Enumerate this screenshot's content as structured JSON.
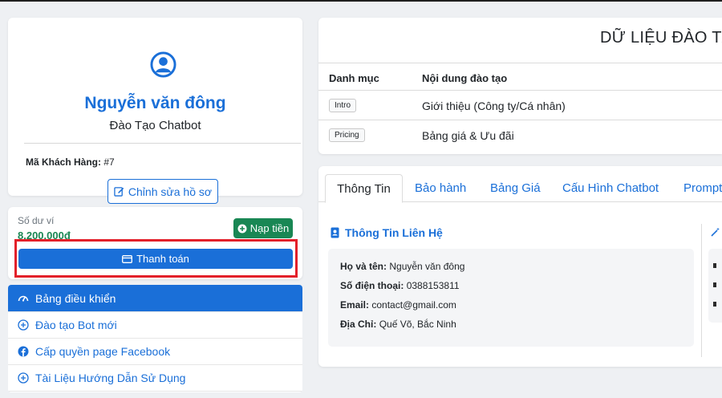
{
  "profile": {
    "name": "Nguyễn văn đông",
    "role": "Đào Tạo Chatbot",
    "customer_id_label": "Mã Khách Hàng:",
    "customer_id_value": "#7",
    "edit_button": "Chỉnh sửa hồ sơ"
  },
  "wallet": {
    "label": "Số dư ví",
    "amount": "8.200.000đ",
    "topup_button": "Nạp tiền",
    "pay_button": "Thanh toán"
  },
  "menu": {
    "items": [
      {
        "label": "Bảng điều khiển",
        "icon": "dashboard-icon"
      },
      {
        "label": "Đào tạo Bot mới",
        "icon": "plus-circle-icon"
      },
      {
        "label": "Cấp quyền page Facebook",
        "icon": "facebook-icon"
      },
      {
        "label": "Tài Liệu Hướng Dẫn Sử Dụng",
        "icon": "plus-circle-icon"
      }
    ]
  },
  "training_data": {
    "title": "DỮ LIỆU ĐÀO TẠ",
    "headers": [
      "Danh mục",
      "Nội dung đào tạo"
    ],
    "rows": [
      {
        "tag": "Intro",
        "content": "Giới thiệu (Công ty/Cá nhân)"
      },
      {
        "tag": "Pricing",
        "content": "Bảng giá & Ưu đãi"
      }
    ]
  },
  "tabs": {
    "items": [
      "Thông Tin",
      "Bảo hành",
      "Bảng Giá",
      "Cấu Hình Chatbot",
      "Prompt"
    ],
    "active": "Thông Tin"
  },
  "contact": {
    "title": "Thông Tin Liên Hệ",
    "full_name_label": "Họ và tên:",
    "full_name": "Nguyễn văn đông",
    "phone_label": "Số điện thoại:",
    "phone": "0388153811",
    "email_label": "Email:",
    "email": "contact@gmail.com",
    "address_label": "Địa Chỉ:",
    "address": "Quế Võ, Bắc Ninh"
  },
  "colors": {
    "primary": "#1a6fd8",
    "success": "#198754",
    "highlight": "#e3202a"
  }
}
